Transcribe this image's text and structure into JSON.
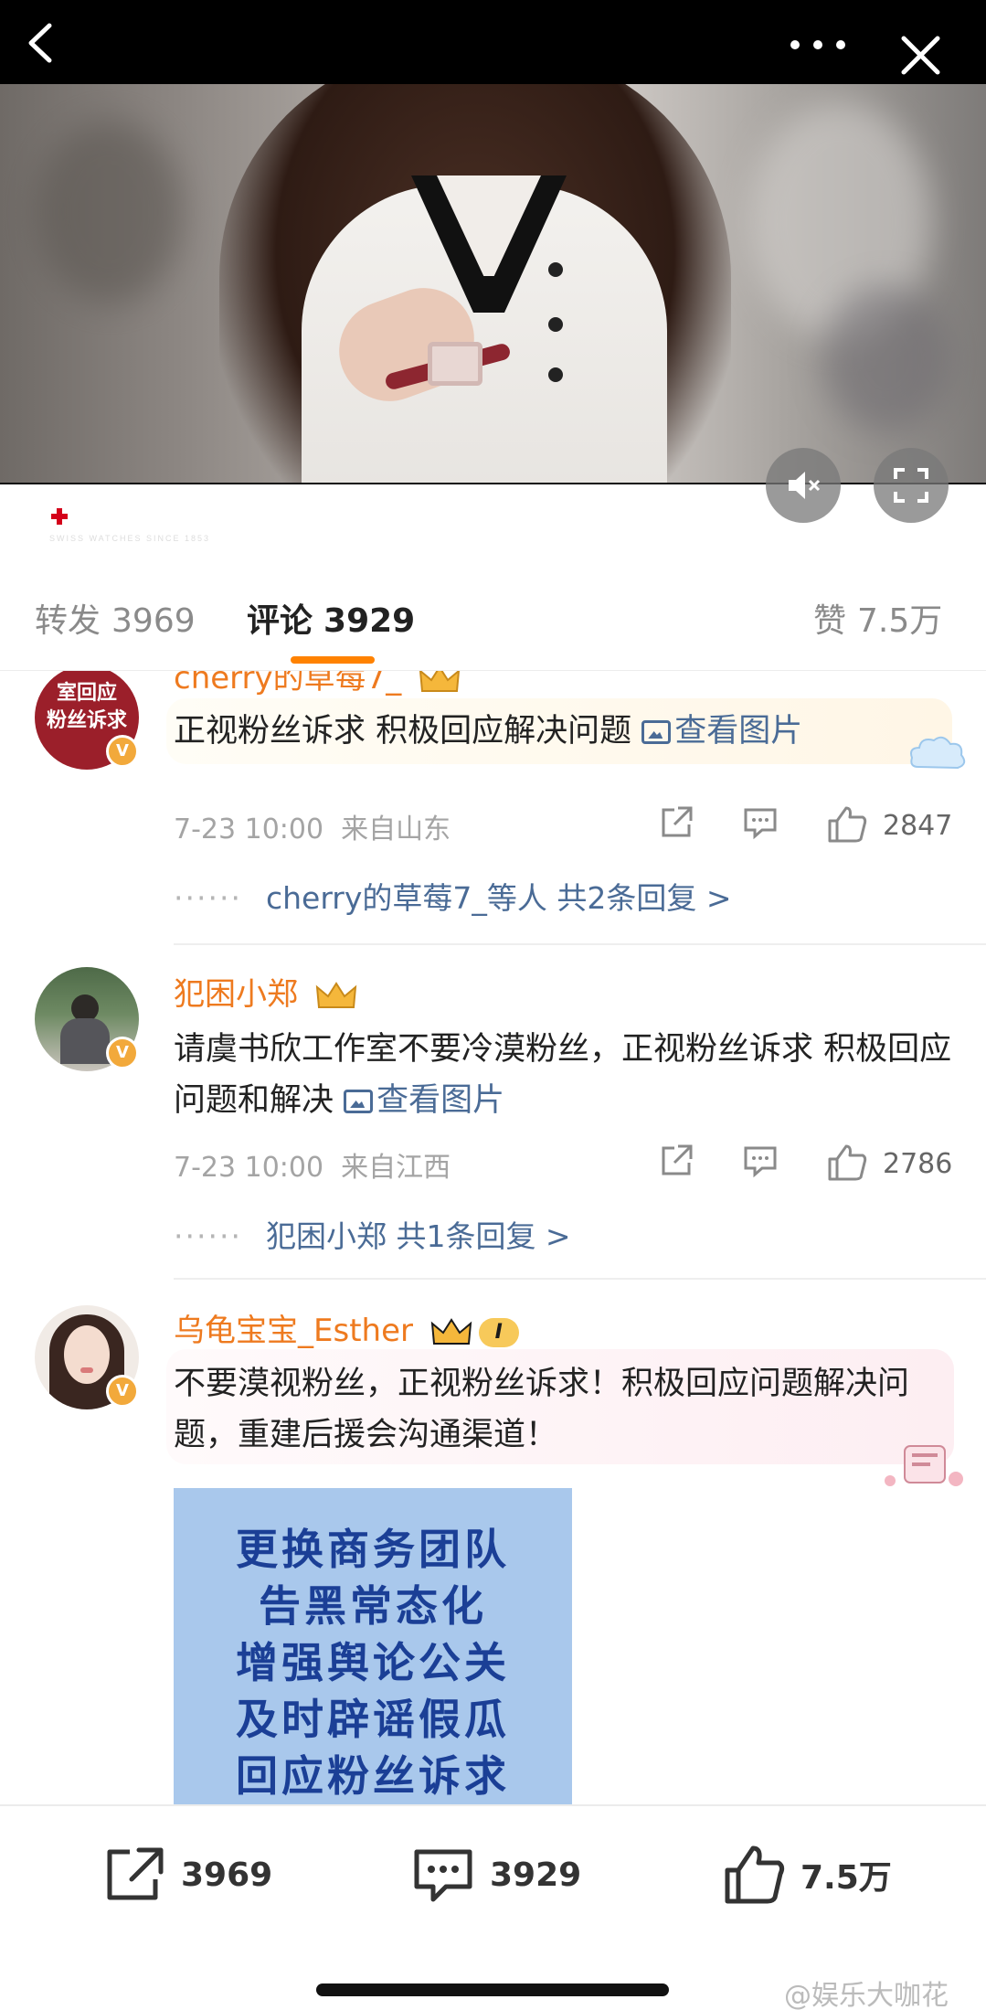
{
  "video": {
    "brand": "TISSOT",
    "brand_tagline": "SWISS WATCHES SINCE 1853"
  },
  "tabs": {
    "repost_label": "转发",
    "repost_count": "3969",
    "comment_label": "评论",
    "comment_count": "3929",
    "like_label": "赞",
    "like_count": "7.5万"
  },
  "comments": [
    {
      "avatar_text_1": "室回应",
      "avatar_text_2": "粉丝诉求",
      "username": "cherry的草莓7_",
      "text": "正视粉丝诉求 积极回应解决问题",
      "image_link": "查看图片",
      "time": "7-23 10:00",
      "location": "来自山东",
      "likes": "2847",
      "replies": "cherry的草莓7_等人  共2条回复 >"
    },
    {
      "username": "犯困小郑",
      "text": "请虞书欣工作室不要冷漠粉丝，正视粉丝诉求 积极回应问题和解决",
      "image_link": "查看图片",
      "time": "7-23 10:00",
      "location": "来自江西",
      "likes": "2786",
      "replies": "犯困小郑  共1条回复 >"
    },
    {
      "username": "乌龟宝宝_Esther",
      "level_badge": "I",
      "text": "不要漠视粉丝，正视粉丝诉求！积极回应问题解决问题，重建后援会沟通渠道！",
      "poster_lines": [
        "更换商务团队",
        "告黑常态化",
        "增强舆论公关",
        "及时辟谣假瓜",
        "回应粉丝诉求"
      ]
    }
  ],
  "bottom_bar": {
    "share_count": "3969",
    "comment_count": "3929",
    "like_count": "7.5万"
  },
  "watermark": "@娱乐大咖花",
  "colors": {
    "accent": "#ff8200",
    "username": "#ee7a1f",
    "link": "#4a6b96"
  }
}
